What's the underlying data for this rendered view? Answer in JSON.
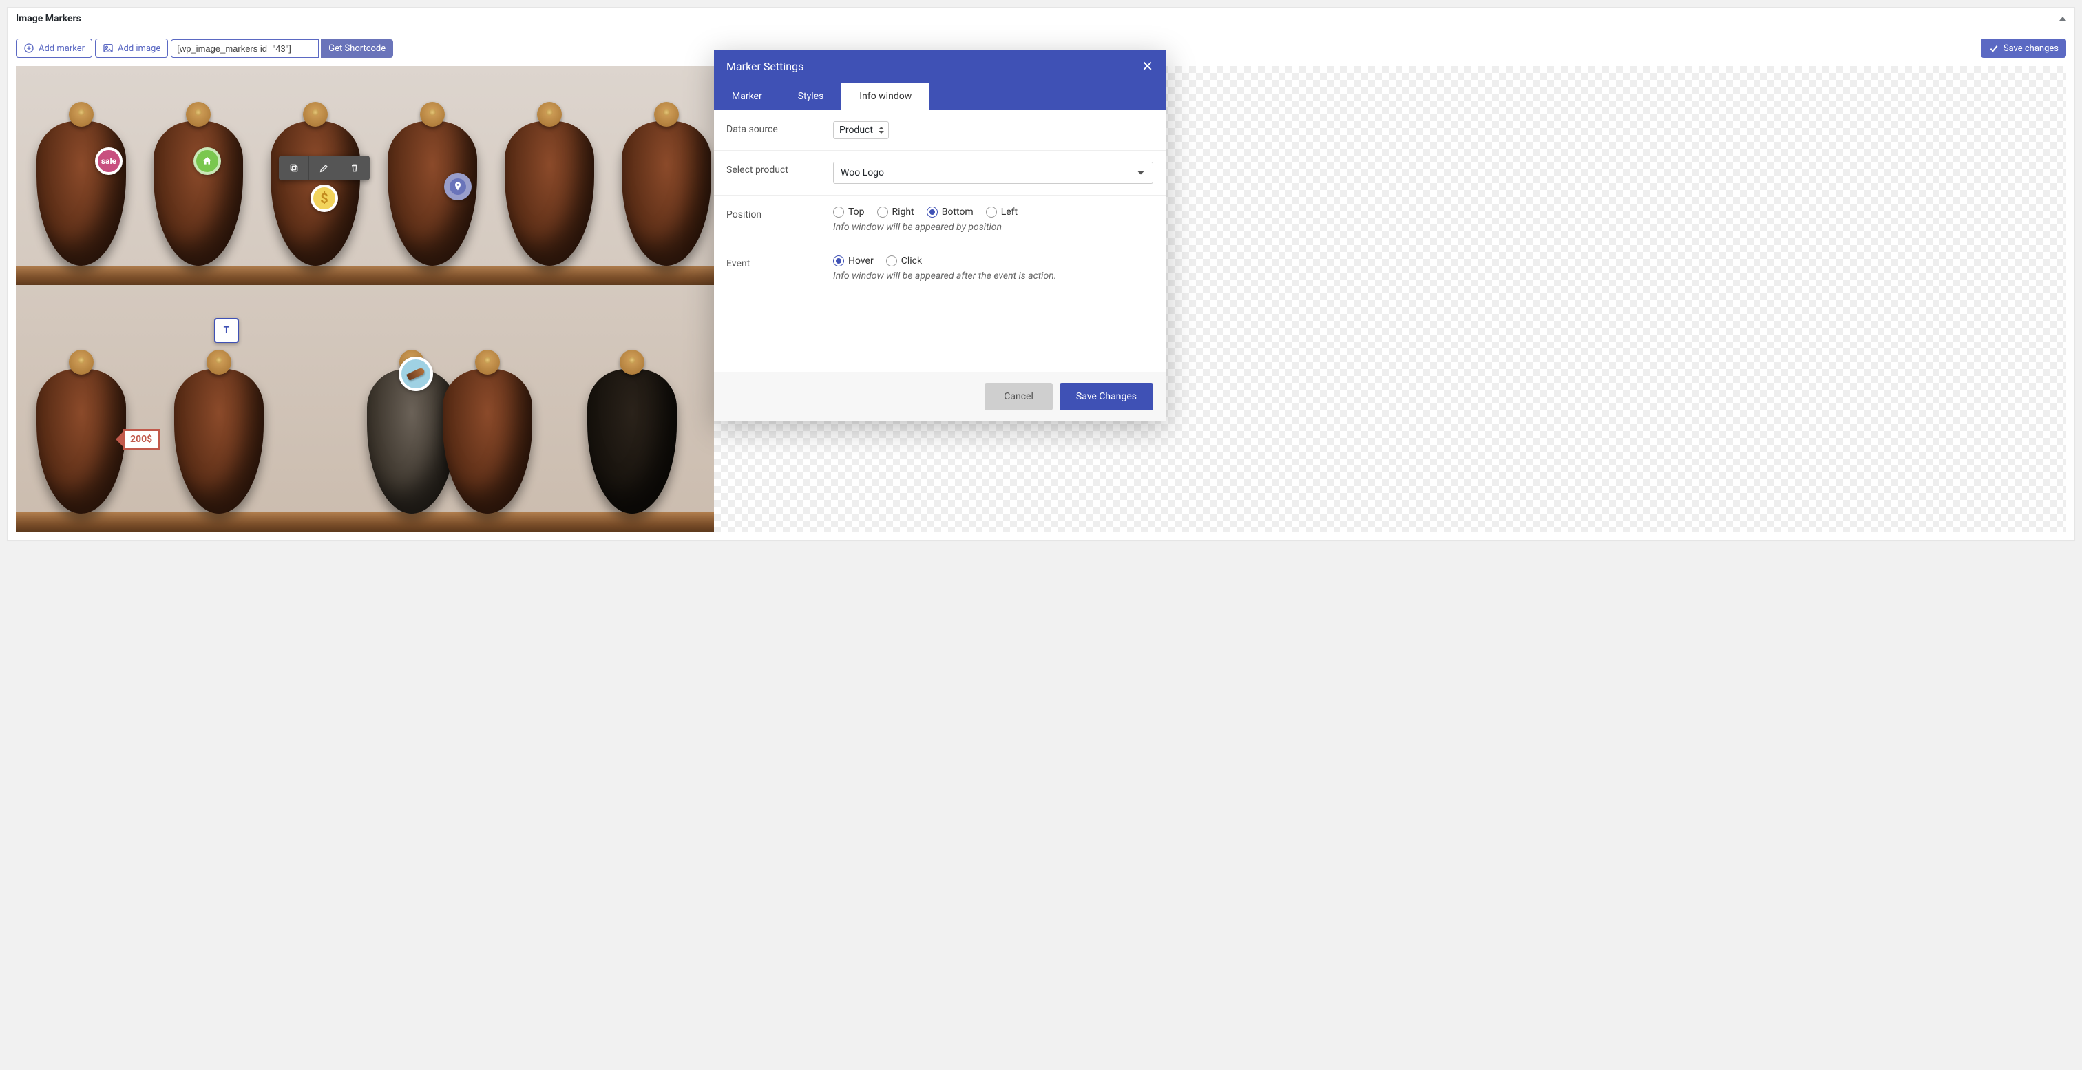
{
  "panel": {
    "title": "Image Markers"
  },
  "toolbar": {
    "add_marker": "Add marker",
    "add_image": "Add image",
    "shortcode": "[wp_image_markers id=\"43\"]",
    "get_shortcode": "Get Shortcode",
    "save_changes": "Save changes"
  },
  "markers": {
    "sale": "sale",
    "t": "T",
    "dollar": "$",
    "price": "200$"
  },
  "modal": {
    "title": "Marker Settings",
    "tabs": {
      "marker": "Marker",
      "styles": "Styles",
      "info_window": "Info window"
    },
    "fields": {
      "data_source": {
        "label": "Data source",
        "value": "Product"
      },
      "select_product": {
        "label": "Select product",
        "value": "Woo Logo"
      },
      "position": {
        "label": "Position",
        "options": {
          "top": "Top",
          "right": "Right",
          "bottom": "Bottom",
          "left": "Left"
        },
        "hint": "Info window will be appeared by position"
      },
      "event": {
        "label": "Event",
        "options": {
          "hover": "Hover",
          "click": "Click"
        },
        "hint": "Info window will be appeared after the event is action."
      }
    },
    "footer": {
      "cancel": "Cancel",
      "save": "Save Changes"
    }
  }
}
